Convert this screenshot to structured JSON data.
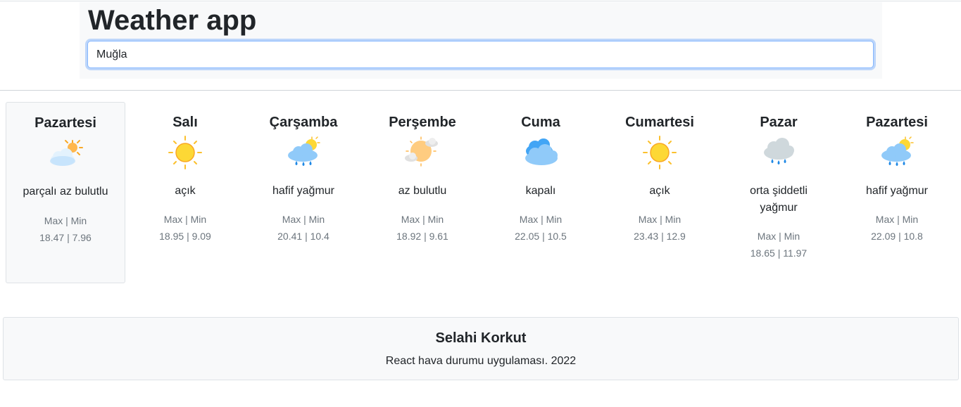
{
  "header": {
    "title": "Weather app",
    "search_value": "Muğla"
  },
  "days": [
    {
      "name": "Pazartesi",
      "icon": "partly-cloudy-icon",
      "description": "parçalı az bulutlu",
      "label": "Max | Min",
      "values": "18.47 | 7.96"
    },
    {
      "name": "Salı",
      "icon": "sun-icon",
      "description": "açık",
      "label": "Max | Min",
      "values": "18.95 | 9.09"
    },
    {
      "name": "Çarşamba",
      "icon": "sun-rain-cloud-icon",
      "description": "hafif yağmur",
      "label": "Max | Min",
      "values": "20.41 | 10.4"
    },
    {
      "name": "Perşembe",
      "icon": "sun-behind-clouds-icon",
      "description": "az bulutlu",
      "label": "Max | Min",
      "values": "18.92 | 9.61"
    },
    {
      "name": "Cuma",
      "icon": "overcast-cloud-icon",
      "description": "kapalı",
      "label": "Max | Min",
      "values": "22.05 | 10.5"
    },
    {
      "name": "Cumartesi",
      "icon": "sun-icon",
      "description": "açık",
      "label": "Max | Min",
      "values": "23.43 | 12.9"
    },
    {
      "name": "Pazar",
      "icon": "rain-cloud-icon",
      "description": "orta şiddetli yağmur",
      "label": "Max | Min",
      "values": "18.65 | 11.97"
    },
    {
      "name": "Pazartesi",
      "icon": "sun-rain-cloud-icon",
      "description": "hafif yağmur",
      "label": "Max | Min",
      "values": "22.09 | 10.8"
    }
  ],
  "footer": {
    "name": "Selahi Korkut",
    "text": "React hava durumu uygulaması. 2022"
  },
  "colors": {
    "sun": "#fdd835",
    "sun_stroke": "#f9a825",
    "cloud_light": "#bbdefb",
    "cloud_blue": "#64b5f6",
    "cloud_grey": "#cfd8dc",
    "rain": "#1e88e5"
  }
}
